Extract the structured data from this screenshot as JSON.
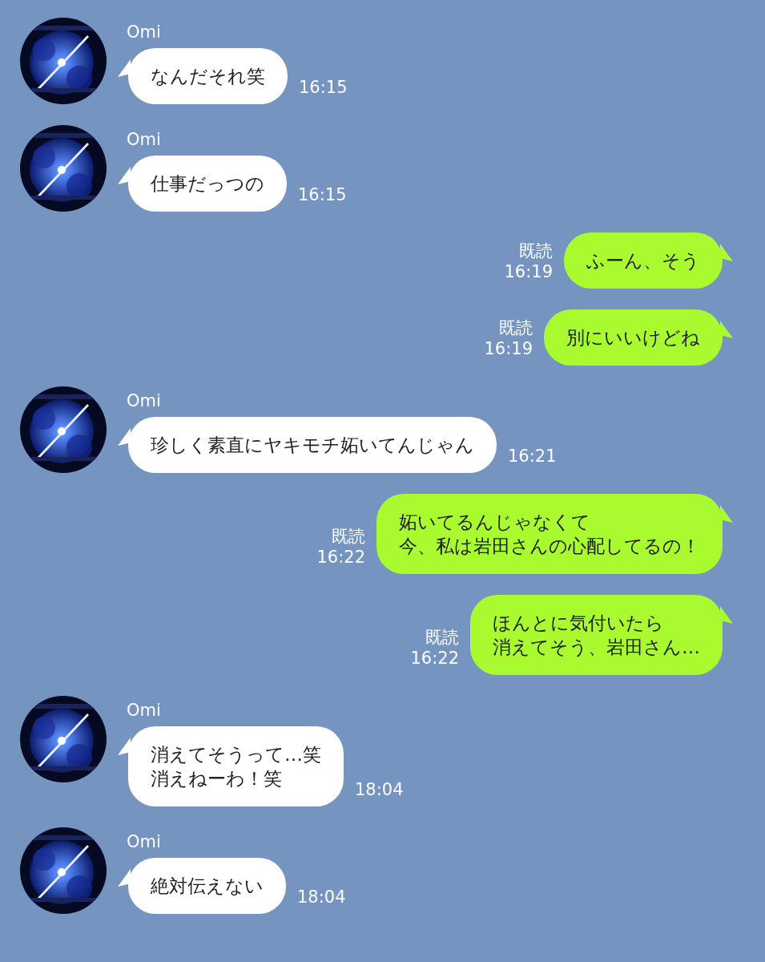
{
  "messages": [
    {
      "kind": "incoming",
      "sender": "Omi",
      "avatar": {
        "kind": "picture"
      },
      "lines": [
        "なんだそれ笑"
      ],
      "time": "16:15"
    },
    {
      "kind": "incoming",
      "sender": "Omi",
      "avatar": {
        "kind": "picture"
      },
      "lines": [
        "仕事だっつの"
      ],
      "time": "16:15"
    },
    {
      "kind": "outgoing",
      "read_label": "既読",
      "time": "16:19",
      "lines": [
        "ふーん、そう"
      ]
    },
    {
      "kind": "outgoing",
      "read_label": "既読",
      "time": "16:19",
      "lines": [
        "別にいいけどね"
      ]
    },
    {
      "kind": "incoming",
      "sender": "Omi",
      "avatar": {
        "kind": "picture"
      },
      "lines": [
        "珍しく素直にヤキモチ妬いてんじゃん"
      ],
      "time": "16:21"
    },
    {
      "kind": "outgoing",
      "read_label": "既読",
      "time": "16:22",
      "lines": [
        "妬いてるんじゃなくて",
        "今、私は岩田さんの心配してるの！"
      ]
    },
    {
      "kind": "outgoing",
      "read_label": "既読",
      "time": "16:22",
      "lines": [
        "ほんとに気付いたら",
        "消えてそう、岩田さん…"
      ]
    },
    {
      "kind": "incoming",
      "sender": "Omi",
      "avatar": {
        "kind": "picture"
      },
      "lines": [
        "消えてそうって…笑",
        "消えねーわ！笑"
      ],
      "time": "18:04"
    },
    {
      "kind": "incoming",
      "sender": "Omi",
      "avatar": {
        "kind": "picture"
      },
      "lines": [
        "絶対伝えない"
      ],
      "time": "18:04"
    }
  ]
}
